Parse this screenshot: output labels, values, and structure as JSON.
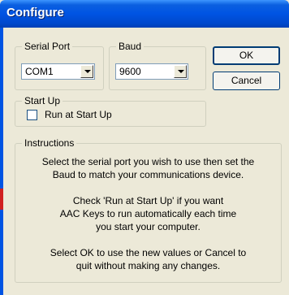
{
  "window": {
    "title": "Configure"
  },
  "serial_port": {
    "label": "Serial Port",
    "selected": "COM1"
  },
  "baud": {
    "label": "Baud",
    "selected": "9600"
  },
  "buttons": {
    "ok": "OK",
    "cancel": "Cancel"
  },
  "startup": {
    "label": "Start Up",
    "checkbox_label": "Run at Start Up",
    "checked": false
  },
  "instructions": {
    "label": "Instructions",
    "lines": [
      "Select the serial port you wish to use then set the",
      "Baud to match your communications device.",
      "",
      "Check 'Run at Start Up' if you want",
      "AAC Keys to run automatically each time",
      "you start your computer.",
      "",
      "Select OK to use the new values or Cancel to",
      "quit without making any changes."
    ]
  },
  "colors": {
    "titlebar": "#0054e3",
    "face": "#ece9d8",
    "group_border": "#d0d0bf",
    "field_border": "#7f9db9"
  }
}
